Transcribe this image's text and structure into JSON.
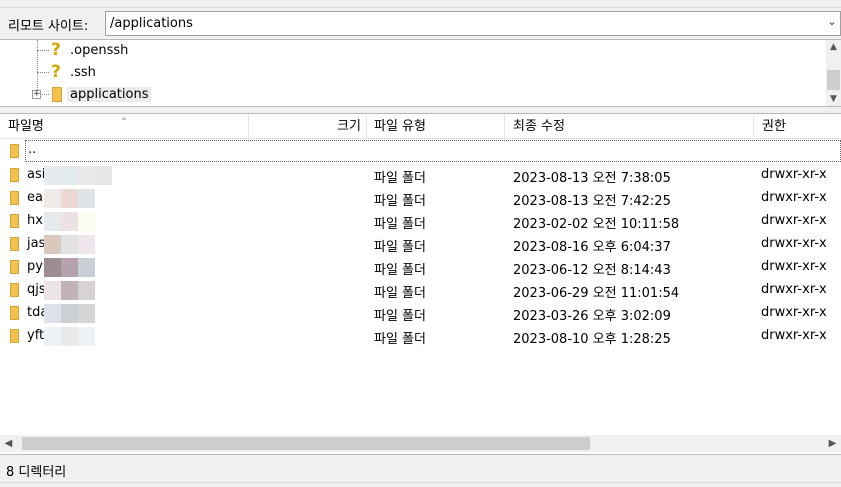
{
  "remote_site": {
    "label": "리모트 사이트:",
    "path": "/applications"
  },
  "tree": {
    "items": [
      {
        "name": ".openssh",
        "icon": "question-icon"
      },
      {
        "name": ".ssh",
        "icon": "question-icon"
      },
      {
        "name": "applications",
        "icon": "folder-icon"
      }
    ]
  },
  "columns": {
    "name": "파일명",
    "size": "크기",
    "type": "파일 유형",
    "modified": "최종 수정",
    "permissions": "권한"
  },
  "parent_row": {
    "name": ".."
  },
  "files": [
    {
      "name": "asi",
      "type": "파일 폴더",
      "modified": "2023-08-13 오전 7:38:05",
      "perm": "drwxr-xr-x"
    },
    {
      "name": "ea",
      "type": "파일 폴더",
      "modified": "2023-08-13 오전 7:42:25",
      "perm": "drwxr-xr-x"
    },
    {
      "name": "hx",
      "type": "파일 폴더",
      "modified": "2023-02-02 오전 10:11:58",
      "perm": "drwxr-xr-x"
    },
    {
      "name": "jas",
      "type": "파일 폴더",
      "modified": "2023-08-16 오후 6:04:37",
      "perm": "drwxr-xr-x"
    },
    {
      "name": "py",
      "type": "파일 폴더",
      "modified": "2023-06-12 오전 8:14:43",
      "perm": "drwxr-xr-x"
    },
    {
      "name": "qjs",
      "type": "파일 폴더",
      "modified": "2023-06-29 오전 11:01:54",
      "perm": "drwxr-xr-x"
    },
    {
      "name": "tda",
      "type": "파일 폴더",
      "modified": "2023-03-26 오후 3:02:09",
      "perm": "drwxr-xr-x"
    },
    {
      "name": "yft",
      "type": "파일 폴더",
      "modified": "2023-08-10 오후 1:28:25",
      "perm": "drwxr-xr-x"
    }
  ],
  "status": {
    "text": "8 디렉터리"
  },
  "colors": {
    "folder": "#f2c14e",
    "question": "#d4a400"
  }
}
